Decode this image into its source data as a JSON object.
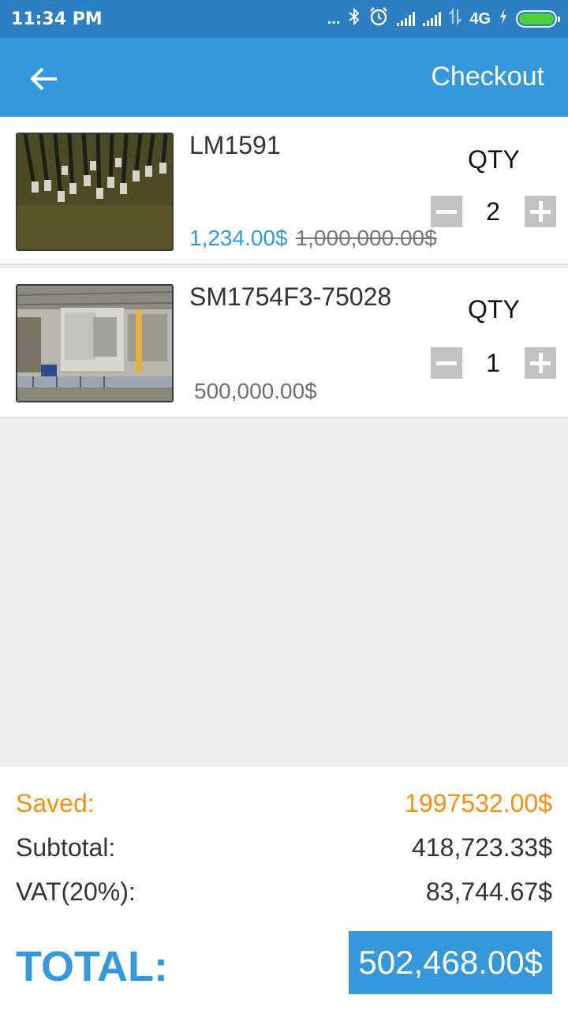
{
  "status_bar": {
    "time": "11:34 PM",
    "dots": "...",
    "network": "4G",
    "icons": [
      "bluetooth-icon",
      "alarm-icon",
      "signal-icon",
      "signal-icon",
      "data-transfer-icon",
      "charging-icon",
      "battery-icon"
    ]
  },
  "app_bar": {
    "back_icon": "arrow-left-icon",
    "checkout_label": "Checkout",
    "color": "#3498db"
  },
  "cart": {
    "items": [
      {
        "name": "LM1591",
        "price": "1,234.00$",
        "old_price": "1,000,000.00$",
        "qty_label": "QTY",
        "qty": "2",
        "image": "steel-rods-photo"
      },
      {
        "name": "SM1754F3-75028",
        "price": "500,000.00$",
        "qty_label": "QTY",
        "qty": "1",
        "image": "factory-machine-photo"
      }
    ]
  },
  "summary": {
    "saved_label": "Saved:",
    "saved_value": "1997532.00$",
    "subtotal_label": "Subtotal:",
    "subtotal_value": "418,723.33$",
    "vat_label": "VAT(20%):",
    "vat_value": "83,744.67$",
    "total_label": "TOTAL:",
    "total_value": "502,468.00$",
    "saved_color": "#f39012",
    "accent_color": "#3498db"
  }
}
